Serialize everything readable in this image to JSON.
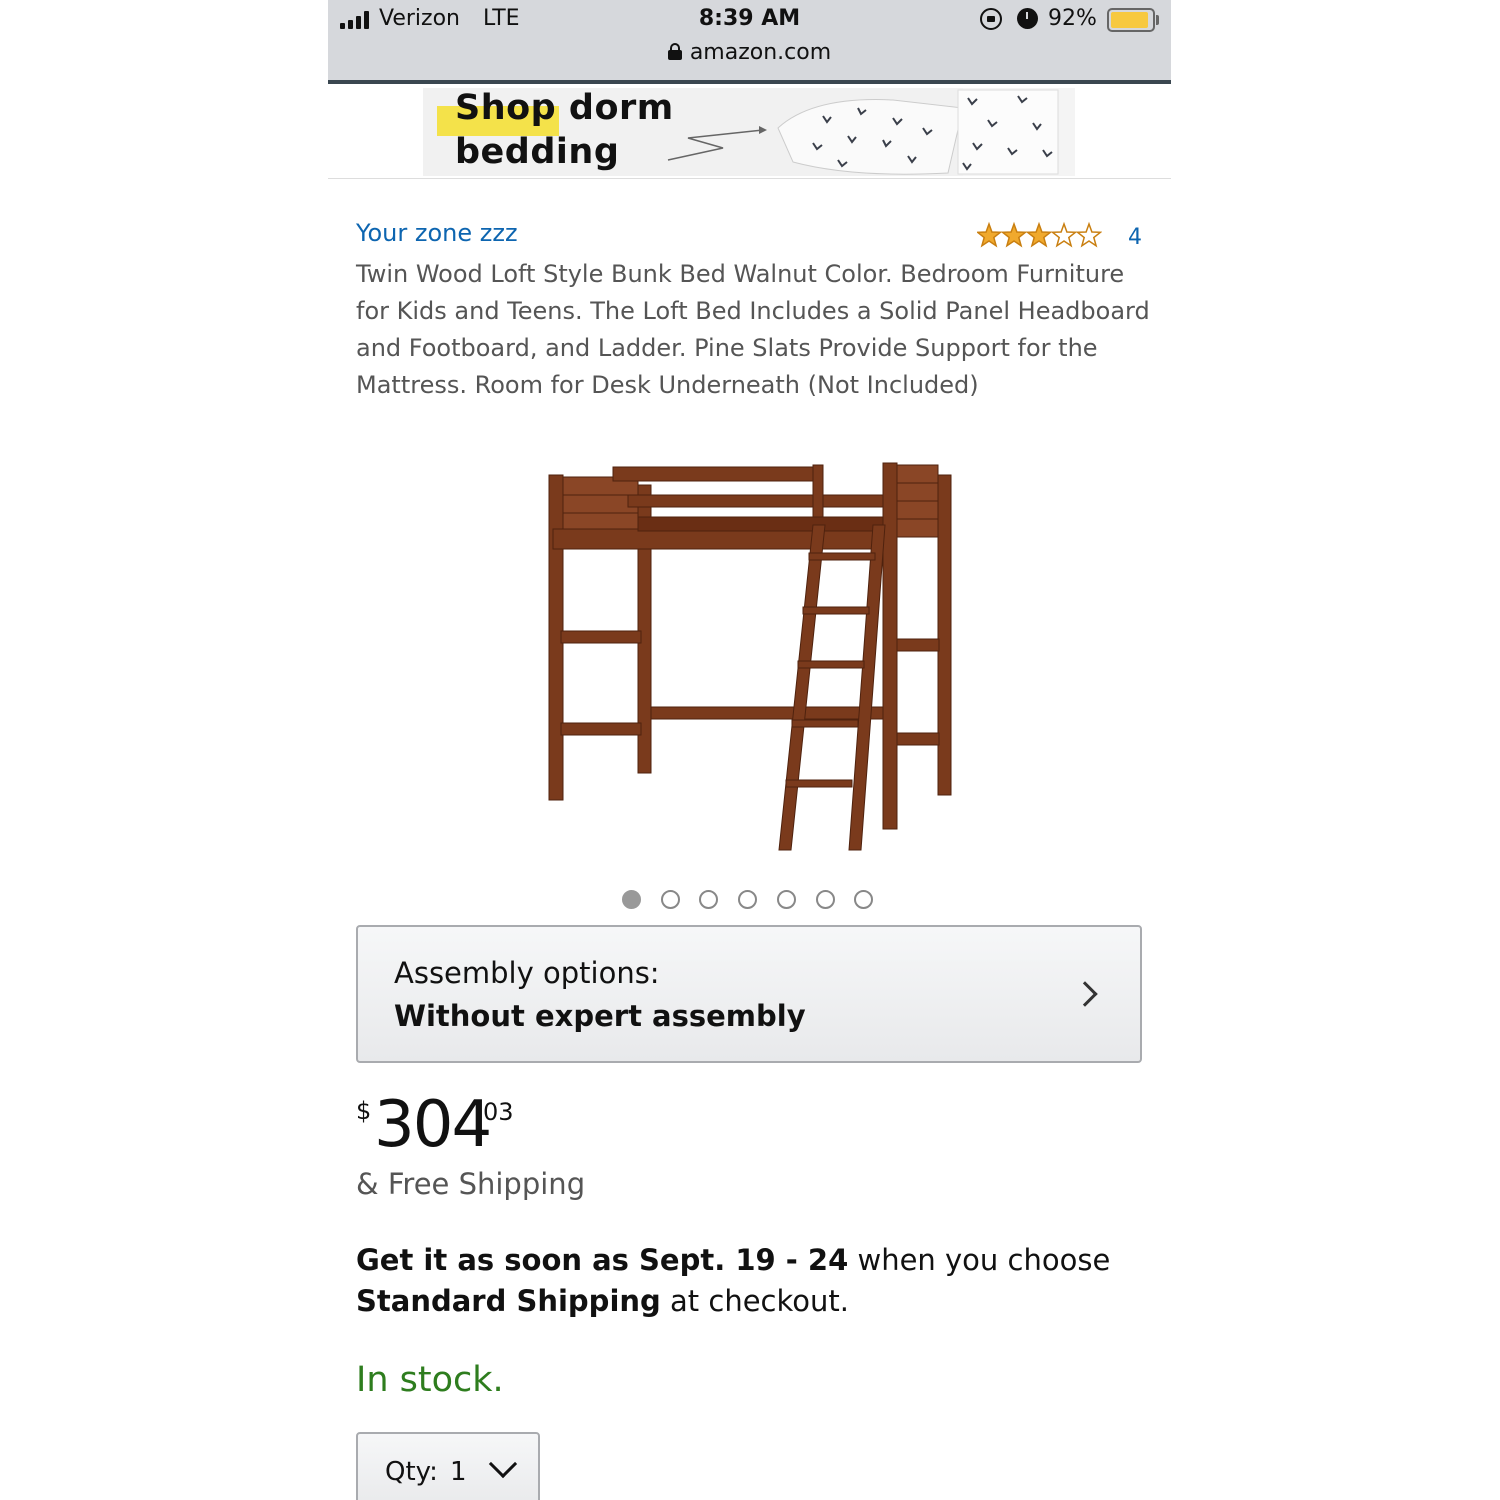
{
  "status_bar": {
    "carrier": "Verizon",
    "network": "LTE",
    "time": "8:39 AM",
    "battery_percent": "92%",
    "battery_level": 0.92,
    "icons": [
      "signal-bars-icon",
      "rotation-lock-icon",
      "alarm-icon",
      "battery-icon"
    ]
  },
  "browser": {
    "url": "amazon.com",
    "icon": "padlock-icon"
  },
  "ad": {
    "line1": "Shop dorm",
    "line2": "bedding",
    "highlight_color": "#f4e24a"
  },
  "product": {
    "brand": "Your zone zzz",
    "rating": 3,
    "rating_max": 5,
    "review_count": "4",
    "title": "Twin Wood Loft Style Bunk Bed Walnut Color. Bedroom Furniture for Kids and Teens. The Loft Bed Includes a Solid Panel Headboard and Footboard, and Ladder. Pine Slats Provide Support for the Mattress. Room for Desk Underneath (Not Included)",
    "image_icon": "loft-bed-image",
    "image_count": 7,
    "active_image": 1
  },
  "assembly": {
    "label": "Assembly options:",
    "value": "Without expert assembly"
  },
  "price": {
    "symbol": "$",
    "whole": "304",
    "fraction": "03",
    "shipping": "& Free Shipping"
  },
  "delivery": {
    "part1": "Get it as soon as Sept. 19 - 24",
    "part2": " when you choose ",
    "part3": "Standard Shipping",
    "part4": " at checkout."
  },
  "stock": {
    "status": "In stock.",
    "color": "#2e7d1e"
  },
  "quantity": {
    "label": "Qty:",
    "value": "1"
  },
  "colors": {
    "link": "#0d65b0",
    "star": "#f0a92d",
    "wood": "#7a3a1c"
  }
}
